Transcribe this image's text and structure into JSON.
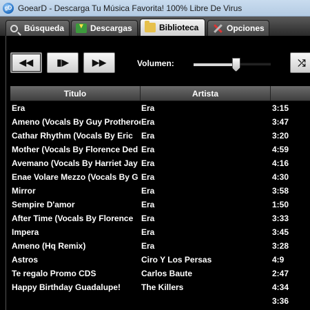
{
  "window": {
    "title": "GoearD - Descarga Tu Música Favorita! 100% Libre De Virus"
  },
  "tabs": [
    {
      "label": "Búsqueda",
      "icon": "search-icon"
    },
    {
      "label": "Descargas",
      "icon": "download-icon"
    },
    {
      "label": "Biblioteca",
      "icon": "folder-icon",
      "active": true
    },
    {
      "label": "Opciones",
      "icon": "tools-icon"
    }
  ],
  "controls": {
    "rewind_glyph": "◀◀",
    "play_glyph": "▮▶",
    "forward_glyph": "▶▶",
    "volume_label": "Volumen:",
    "volume_level": 0.55,
    "shuffle_glyph": "⤮"
  },
  "table": {
    "headers": [
      "Titulo",
      "Artista",
      ""
    ],
    "rows": [
      {
        "title": "Era",
        "artist": "Era",
        "duration": "3:15"
      },
      {
        "title": "Ameno (Vocals By Guy Protheroe",
        "artist": "Era",
        "duration": "3:47"
      },
      {
        "title": "Cathar Rhythm (Vocals By Eric",
        "artist": "Era",
        "duration": "3:20"
      },
      {
        "title": "Mother (Vocals By Florence Ded",
        "artist": "Era",
        "duration": "4:59"
      },
      {
        "title": "Avemano (Vocals By Harriet Jay",
        "artist": "Era",
        "duration": "4:16"
      },
      {
        "title": "Enae Volare Mezzo (Vocals By G",
        "artist": "Era",
        "duration": "4:30"
      },
      {
        "title": "Mirror",
        "artist": "Era",
        "duration": "3:58"
      },
      {
        "title": "Sempire D'amor",
        "artist": "Era",
        "duration": "1:50"
      },
      {
        "title": "After Time (Vocals By Florence",
        "artist": "Era",
        "duration": "3:33"
      },
      {
        "title": "Impera",
        "artist": "Era",
        "duration": "3:45"
      },
      {
        "title": "Ameno (Hq Remix)",
        "artist": "Era",
        "duration": "3:28"
      },
      {
        "title": "Astros",
        "artist": "Ciro Y Los Persas",
        "duration": "4:9"
      },
      {
        "title": "Te regalo Promo CDS",
        "artist": "Carlos Baute",
        "duration": "2:47"
      },
      {
        "title": "Happy Birthday Guadalupe!",
        "artist": "The Killers",
        "duration": "4:34"
      },
      {
        "title": "",
        "artist": "",
        "duration": "3:36"
      }
    ]
  }
}
